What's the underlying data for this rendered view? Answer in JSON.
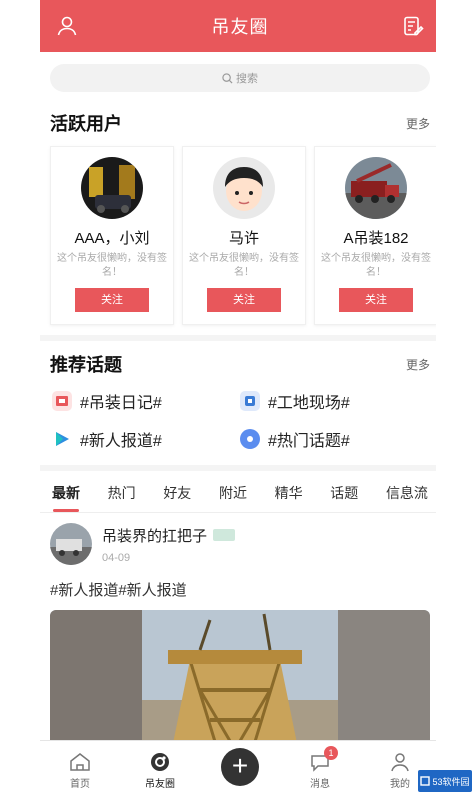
{
  "header": {
    "title": "吊友圈",
    "user_icon": "user-icon",
    "edit_icon": "edit-note-icon"
  },
  "search": {
    "placeholder": "搜索"
  },
  "active_users": {
    "title": "活跃用户",
    "more": "更多",
    "users": [
      {
        "name": "AAA，小刘",
        "desc": "这个吊友很懒哟，没有签名！",
        "follow": "关注"
      },
      {
        "name": "马许",
        "desc": "这个吊友很懒哟，没有签名！",
        "follow": "关注"
      },
      {
        "name": "A吊装182",
        "desc": "这个吊友很懒哟，没有签名！",
        "follow": "关注"
      }
    ]
  },
  "topics": {
    "title": "推荐话题",
    "more": "更多",
    "items": [
      {
        "label": "#吊装日记#",
        "color": "#e8575b"
      },
      {
        "label": "#工地现场#",
        "color": "#3a7bd5"
      },
      {
        "label": "#新人报道#",
        "color": "#2e8fe0"
      },
      {
        "label": "#热门话题#",
        "color": "#5b8def"
      }
    ]
  },
  "tabs": [
    "最新",
    "热门",
    "好友",
    "附近",
    "精华",
    "话题",
    "信息流"
  ],
  "post": {
    "author": "吊装界的扛把子",
    "date": "04-09",
    "text": "#新人报道#新人报道"
  },
  "bottom_nav": [
    {
      "label": "首页",
      "icon": "home-icon"
    },
    {
      "label": "吊友圈",
      "icon": "circle-icon"
    },
    {
      "label": "+",
      "icon": "plus-icon"
    },
    {
      "label": "消息",
      "icon": "message-icon",
      "badge": "1"
    },
    {
      "label": "我的",
      "icon": "profile-icon"
    }
  ],
  "watermark": "53软件园",
  "colors": {
    "accent": "#e8575b"
  }
}
